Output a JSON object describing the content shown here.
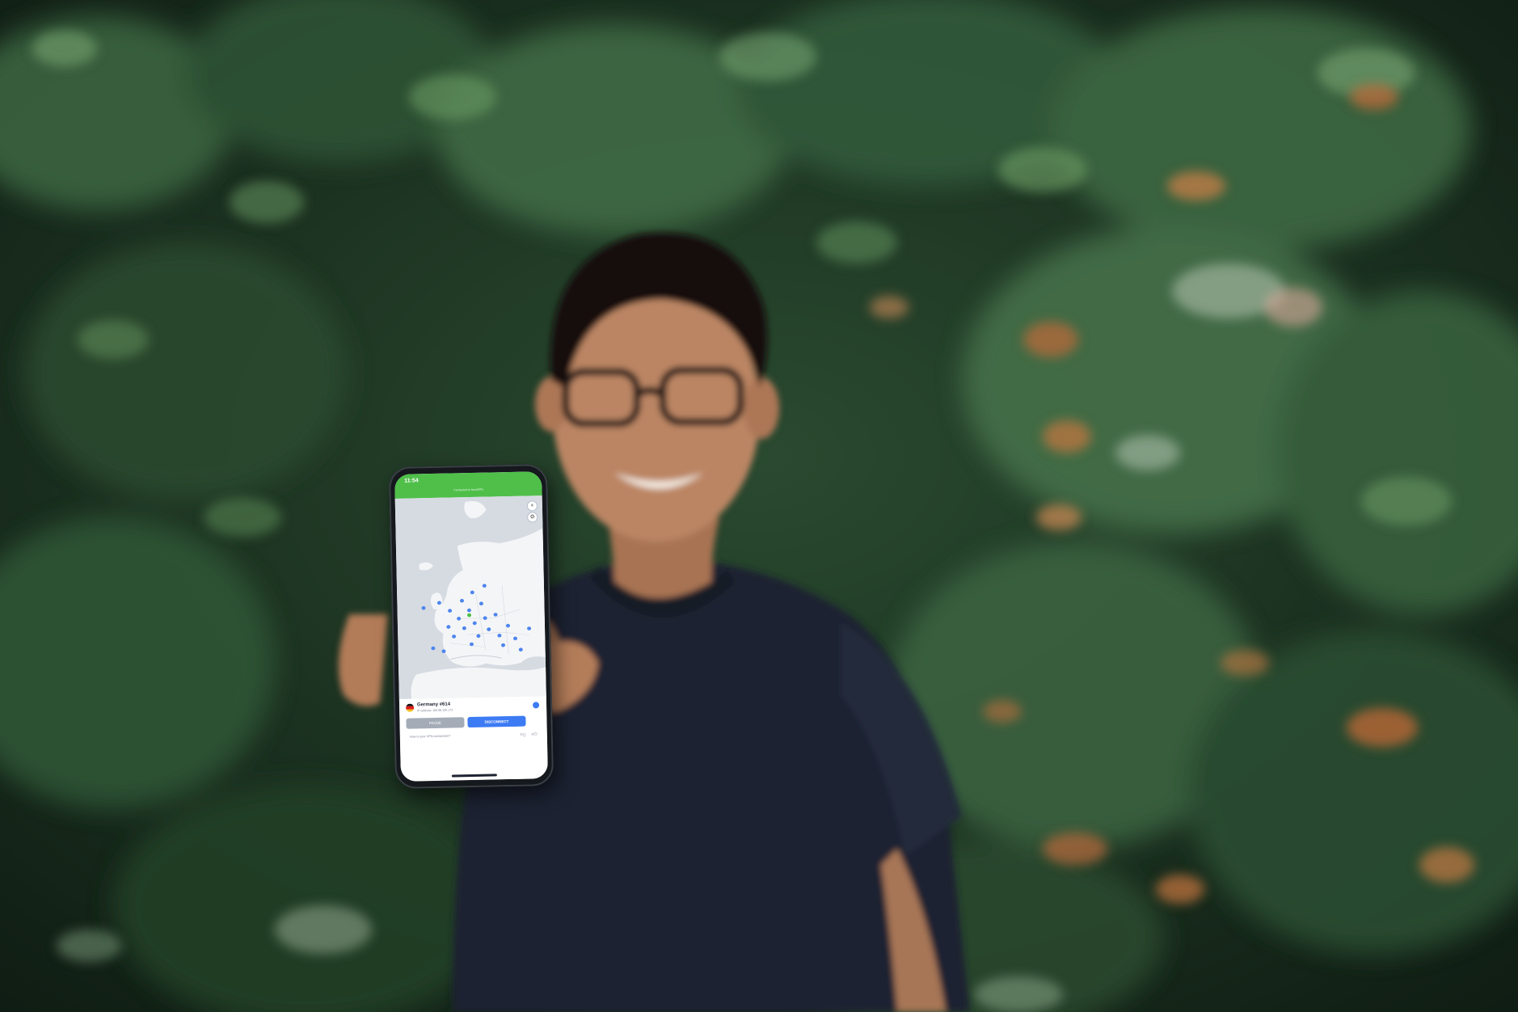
{
  "scene": {
    "description_colors": {
      "foliage_dark": "#142318",
      "foliage_mid": "#2e5234",
      "foliage_light": "#4f7a4a",
      "leaf_accent_orange": "#c8733a",
      "shirt": "#1c2230",
      "skin": "#b98462"
    }
  },
  "app": {
    "status_time": "11:54",
    "status_caption": "Connected to NordVPN",
    "accent_color": "#4fbf4a",
    "server": {
      "name": "Germany #614",
      "ip": "IP address: 185.88.100.173"
    },
    "buttons": {
      "pause": "PAUSE",
      "disconnect": "DISCONNECT"
    },
    "rating_question": "How is your VPN connection?",
    "icons": {
      "map_close": "close-icon",
      "map_settings": "gear-icon",
      "info": "info-icon",
      "thumb_down": "thumb-down-icon",
      "thumb_up": "thumb-up-icon"
    }
  }
}
